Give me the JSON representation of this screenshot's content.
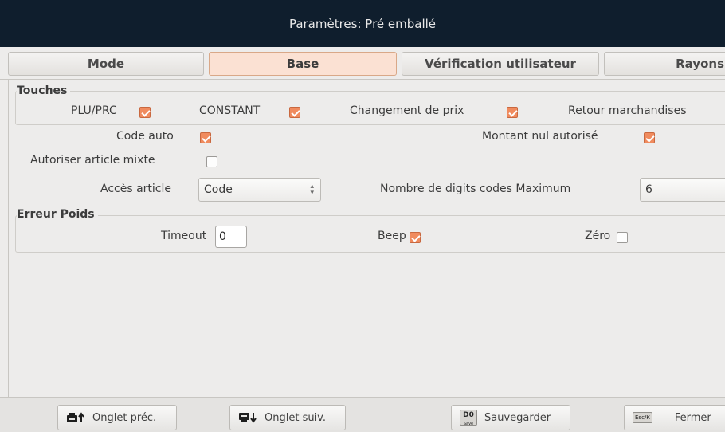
{
  "window": {
    "title": "Paramètres: Pré emballé"
  },
  "tabs": [
    {
      "label": "Mode"
    },
    {
      "label": "Base"
    },
    {
      "label": "Vérification utilisateur"
    },
    {
      "label": "Rayons"
    }
  ],
  "touches": {
    "title": "Touches",
    "plu_prc": {
      "label": "PLU/PRC",
      "checked": true
    },
    "constant": {
      "label": "CONSTANT",
      "checked": true
    },
    "changement_prix": {
      "label": "Changement de prix",
      "checked": true
    },
    "retour": {
      "label": "Retour marchandises"
    }
  },
  "options": {
    "code_auto": {
      "label": "Code auto",
      "checked": true
    },
    "montant_nul": {
      "label": "Montant nul autorisé",
      "checked": true
    },
    "article_mixte": {
      "label": "Autoriser article mixte",
      "checked": false
    },
    "acces_article": {
      "label": "Accès article",
      "value": "Code"
    },
    "nombre_digits": {
      "label": "Nombre de digits codes Maximum",
      "value": "6"
    }
  },
  "erreur_poids": {
    "title": "Erreur Poids",
    "timeout": {
      "label": "Timeout",
      "value": "0"
    },
    "beep": {
      "label": "Beep",
      "checked": true
    },
    "zero": {
      "label": "Zéro",
      "checked": false
    }
  },
  "buttons": {
    "prev": {
      "label": "Onglet préc."
    },
    "next": {
      "label": "Onglet suiv."
    },
    "save": {
      "label": "Sauvegarder",
      "key": "D0",
      "key_sub": "Save"
    },
    "close": {
      "label": "Fermer",
      "key": "Esc/K"
    }
  },
  "colors": {
    "titlebar": "#0f1e2d",
    "accent": "#f08b5e",
    "active_tab": "#fbe1d3"
  }
}
